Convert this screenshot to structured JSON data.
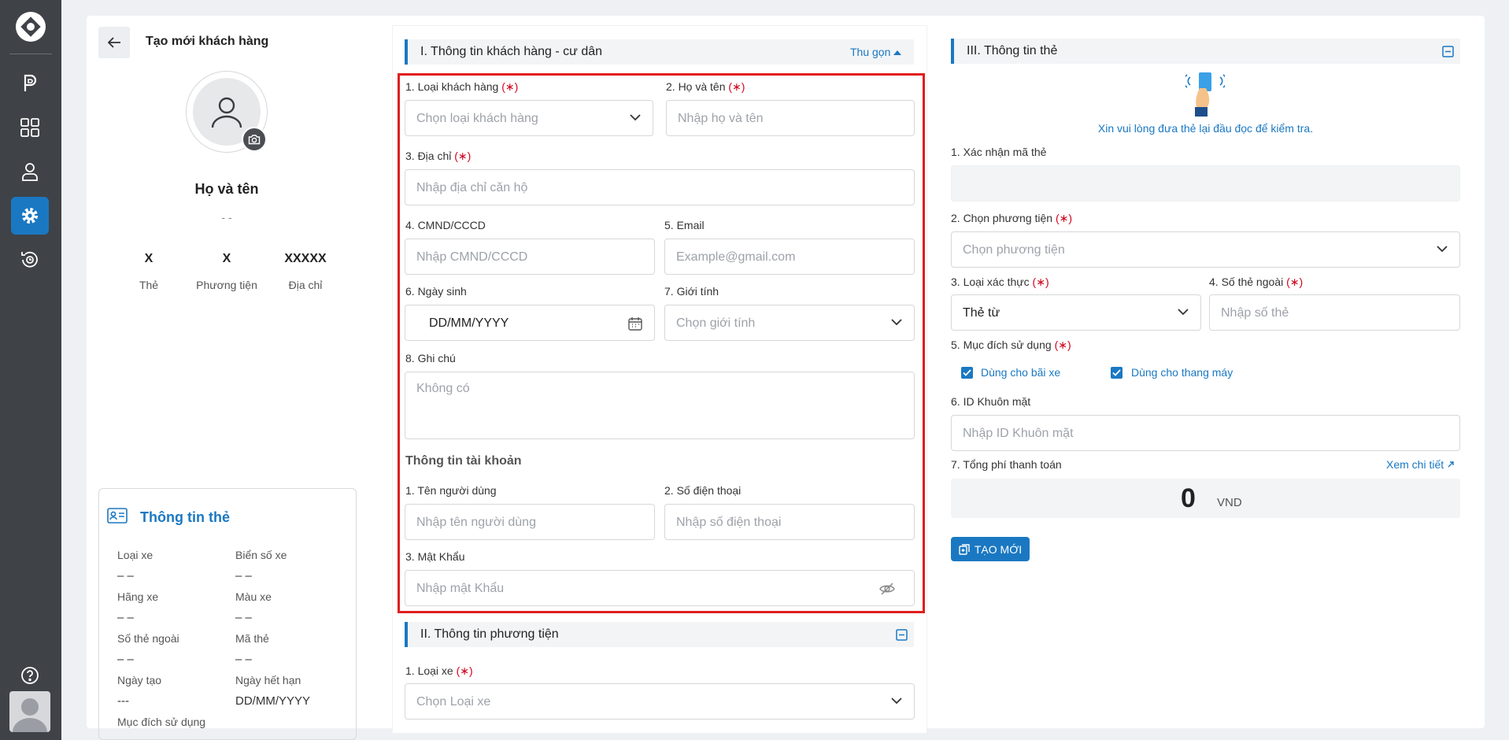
{
  "sidebar": {
    "items": [
      "parking-icon",
      "grid-icon",
      "user-icon",
      "gear-icon",
      "history-icon",
      "help-icon"
    ]
  },
  "header": {
    "title": "Tạo mới khách hàng"
  },
  "profile": {
    "name": "Họ và tên",
    "dash": "- -",
    "stats": [
      {
        "value": "X",
        "label": "Thẻ"
      },
      {
        "value": "X",
        "label": "Phương tiện"
      },
      {
        "value": "XXXXX",
        "label": "Địa chỉ"
      }
    ]
  },
  "card_info": {
    "title": "Thông tin thẻ",
    "fields": [
      {
        "label": "Loại xe",
        "value": "– –"
      },
      {
        "label": "Biển số xe",
        "value": "– –"
      },
      {
        "label": "Hãng xe",
        "value": "– –"
      },
      {
        "label": "Màu xe",
        "value": "– –"
      },
      {
        "label": "Số thẻ ngoài",
        "value": "– –"
      },
      {
        "label": "Mã thẻ",
        "value": "– –"
      },
      {
        "label": "Ngày tạo",
        "value": "---"
      },
      {
        "label": "Ngày hết hạn",
        "value": "DD/MM/YYYY"
      },
      {
        "label": "Mục đích sử dụng",
        "value": ""
      }
    ]
  },
  "section1": {
    "title": "I. Thông tin khách hàng - cư dân",
    "collapse": "Thu gọn",
    "f1": {
      "label": "1. Loại khách hàng",
      "req": "(∗)",
      "placeholder": "Chọn loại khách hàng"
    },
    "f2": {
      "label": "2. Họ và tên",
      "req": "(∗)",
      "placeholder": "Nhập họ và tên"
    },
    "f3": {
      "label": "3. Địa chỉ",
      "req": "(∗)",
      "placeholder": "Nhập địa chỉ căn hộ"
    },
    "f4": {
      "label": "4. CMND/CCCD",
      "placeholder": "Nhập CMND/CCCD"
    },
    "f5": {
      "label": "5. Email",
      "placeholder": "Example@gmail.com"
    },
    "f6": {
      "label": "6. Ngày sinh",
      "value": "DD/MM/YYYY"
    },
    "f7": {
      "label": "7. Giới tính",
      "placeholder": "Chọn giới tính"
    },
    "f8": {
      "label": "8. Ghi chú",
      "placeholder": "Không có"
    },
    "account_title": "Thông tin tài khoản",
    "a1": {
      "label": "1. Tên người dùng",
      "placeholder": "Nhập tên người dùng"
    },
    "a2": {
      "label": "2. Số điện thoại",
      "placeholder": "Nhập số điện thoại"
    },
    "a3": {
      "label": "3. Mật Khẩu",
      "placeholder": "Nhập mật Khẩu"
    }
  },
  "section2": {
    "title": "II. Thông tin phương tiện",
    "v1": {
      "label": "1. Loại xe",
      "req": "(∗)",
      "placeholder": "Chọn Loại xe"
    }
  },
  "section3": {
    "title": "III. Thông tin thẻ",
    "hint": "Xin vui lòng đưa thẻ lại đầu đọc để kiểm tra.",
    "c1": {
      "label": "1. Xác nhận mã thẻ"
    },
    "c2": {
      "label": "2. Chọn phương tiện",
      "req": "(∗)",
      "placeholder": "Chọn phương tiện"
    },
    "c3": {
      "label": "3. Loại xác thực",
      "req": "(∗)",
      "value": "Thẻ từ"
    },
    "c4": {
      "label": "4. Số thẻ ngoài",
      "req": "(∗)",
      "placeholder": "Nhập số thẻ"
    },
    "c5": {
      "label": "5. Mục đích sử dụng",
      "req": "(∗)",
      "opt1": "Dùng cho bãi xe",
      "opt2": "Dùng cho thang máy"
    },
    "c6": {
      "label": "6. ID Khuôn mặt",
      "placeholder": "Nhập ID Khuôn mặt"
    },
    "c7": {
      "label": "7. Tổng phí thanh toán",
      "link": "Xem chi tiết",
      "amount": "0",
      "unit": "VND"
    },
    "create": "TẠO MỚI"
  },
  "colors": {
    "accent": "#1a78c2",
    "required": "#d0021b",
    "highlight": "#e01e1e",
    "sidebar": "#3f4247"
  }
}
